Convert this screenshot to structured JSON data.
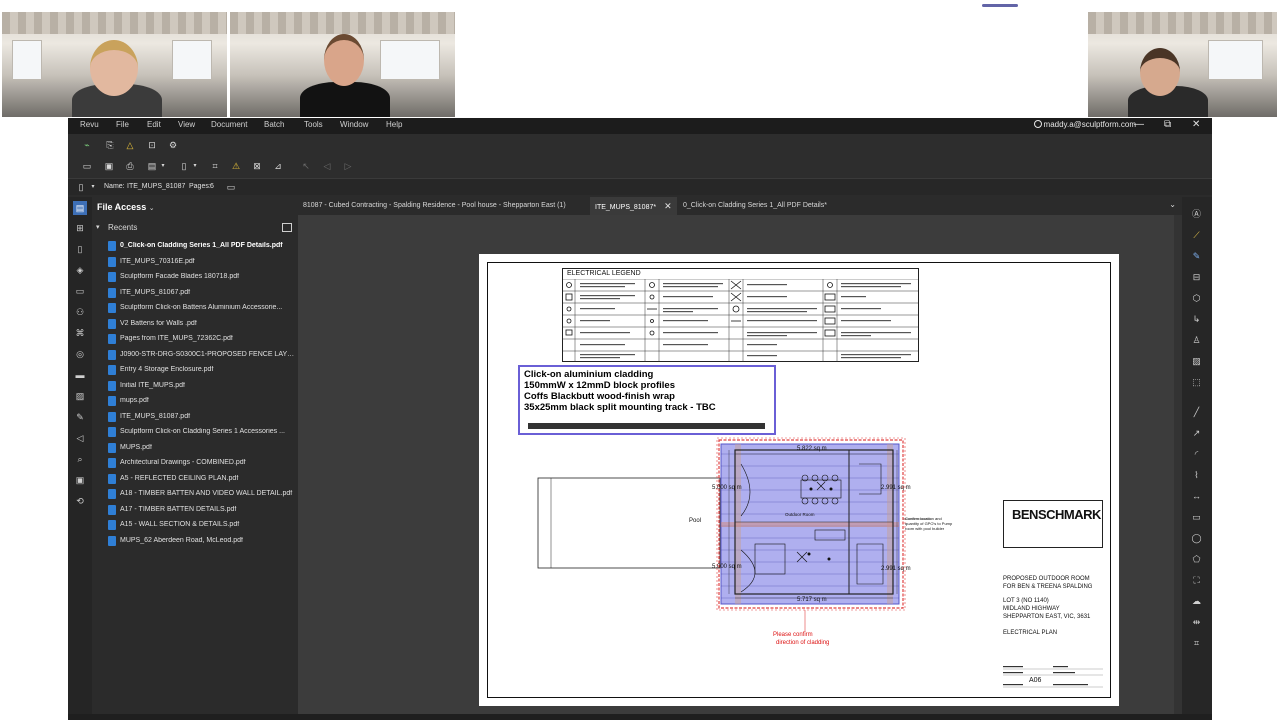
{
  "app": {
    "menu": [
      "Revu",
      "File",
      "Edit",
      "View",
      "Document",
      "Batch",
      "Tools",
      "Window",
      "Help"
    ],
    "user_email": "maddy.a@sculptform.com",
    "window_controls": {
      "minimize": "—",
      "restore": "⧉",
      "close": "✕"
    }
  },
  "properties": {
    "name_label": "Name:",
    "name_value": "ITE_MUPS_81087",
    "pages_label": "Pages:",
    "pages_value": "6"
  },
  "file_access": {
    "title": "File Access",
    "recents_label": "Recents",
    "files": [
      "0_Click-on Cladding Series 1_All PDF Details.pdf",
      "ITE_MUPS_70316E.pdf",
      "Sculptform Facade Blades 180718.pdf",
      "ITE_MUPS_81067.pdf",
      "Sculptform Click-on Battens Aluminium Accessorie...",
      "V2 Battens for Walls .pdf",
      "Pages from ITE_MUPS_72362C.pdf",
      "J0900-STR-DRG-S0300C1-PROPOSED FENCE LAYU...",
      "Entry 4 Storage Enclosure.pdf",
      "Initial ITE_MUPS.pdf",
      "mups.pdf",
      "ITE_MUPS_81087.pdf",
      "Sculptform Click-on Cladding Series 1 Accessories ...",
      "MUPS.pdf",
      "Architectural Drawings - COMBINED.pdf",
      "A5 - REFLECTED CEILING PLAN.pdf",
      "A18 - TIMBER BATTEN AND VIDEO WALL DETAIL.pdf",
      "A17 - TIMBER BATTEN DETAILS.pdf",
      "A15 - WALL SECTION & DETAILS.pdf",
      "MUPS_62 Aberdeen Road, McLeod.pdf"
    ]
  },
  "tabs": [
    {
      "label": "81087 - Cubed Contracting - Spalding Residence - Pool house - Shepparton East (1)",
      "active": false
    },
    {
      "label": "ITE_MUPS_81087*",
      "active": true
    },
    {
      "label": "0_Click-on Cladding Series 1_All PDF Details*",
      "active": false
    }
  ],
  "drawing": {
    "legend_title": "ELECTRICAL LEGEND",
    "callout_lines": [
      "Click-on aluminium cladding",
      "150mmW x 12mmD block profiles",
      "Coffs Blackbutt wood-finish wrap",
      "35x25mm black split mounting track - TBC"
    ],
    "area_top": "5.822 sq m",
    "area_left_top": "5.000 sq m",
    "area_left_bottom": "5.000 sq m",
    "area_right_top": "2.991 sq m",
    "area_right_bottom": "2.991 sq m",
    "area_bottom": "5.717 sq m",
    "pool_label": "Pool",
    "outdoor_room_label": "Outdoor Room",
    "red_note_1": "Please confirm",
    "red_note_2": "direction of cladding",
    "side_note": "Confirm location and quantity of GPO's to Pump room with pool builder",
    "logo_text": "BENSCHMARK",
    "project_line_1": "PROPOSED OUTDOOR ROOM",
    "project_line_2": "FOR BEN & TREENA SPALDING",
    "lot_line_1": "LOT 3 (NO 1140)",
    "lot_line_2": "MIDLAND HIGHWAY",
    "lot_line_3": "SHEPPARTON EAST, VIC, 3631",
    "sheet_title": "ELECTRICAL PLAN",
    "sheet_no": "A06"
  },
  "colors": {
    "accent": "#3d6fb6",
    "callout_border": "#6a5fd6",
    "revision_cloud": "#e04040",
    "highlight_fill": "#8d8de8"
  }
}
